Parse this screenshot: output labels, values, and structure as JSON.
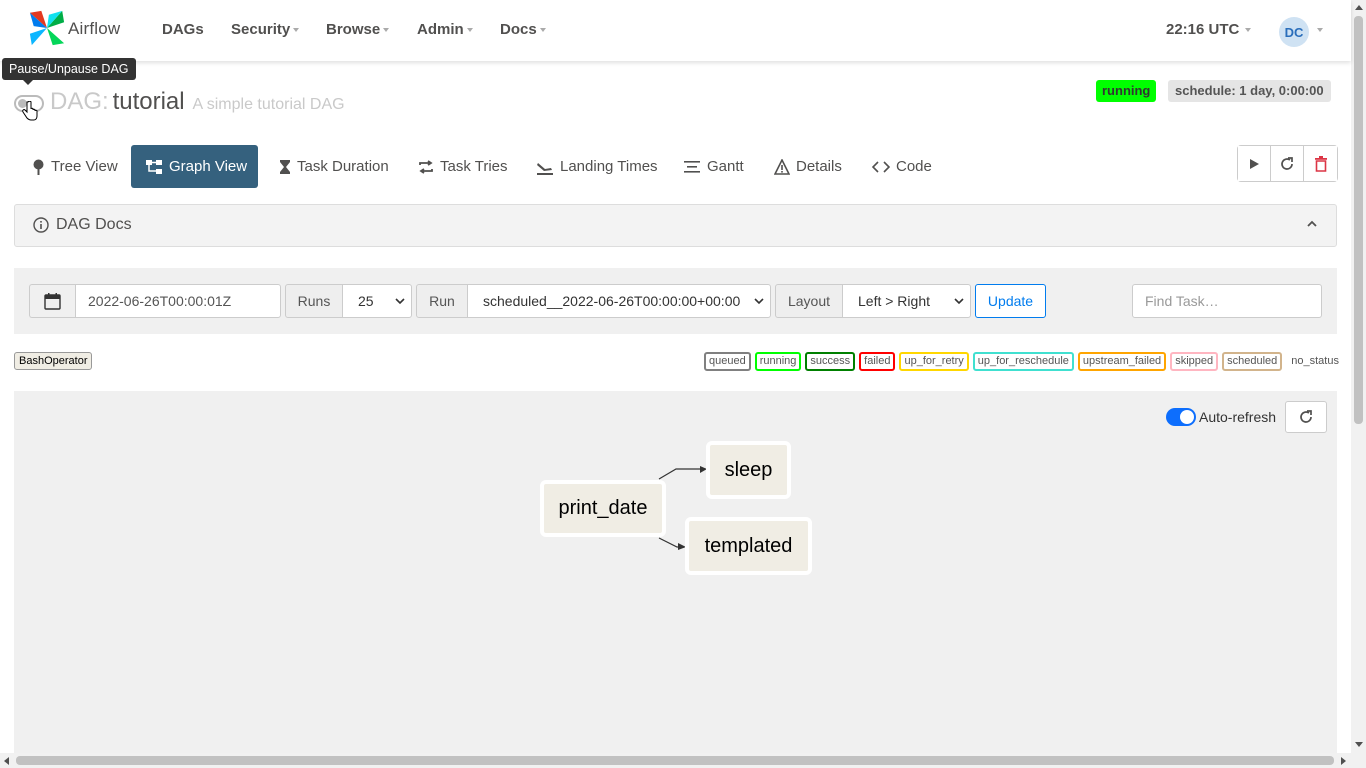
{
  "navbar": {
    "brand": "Airflow",
    "menu": [
      {
        "label": "DAGs",
        "dropdown": false
      },
      {
        "label": "Security",
        "dropdown": true
      },
      {
        "label": "Browse",
        "dropdown": true
      },
      {
        "label": "Admin",
        "dropdown": true
      },
      {
        "label": "Docs",
        "dropdown": true
      }
    ],
    "time": "22:16 UTC",
    "user_initials": "DC"
  },
  "tooltip": "Pause/Unpause DAG",
  "dag": {
    "prefix": "DAG:",
    "name": "tutorial",
    "description": "A simple tutorial DAG",
    "state": "running",
    "schedule": "schedule: 1 day, 0:00:00",
    "paused": true
  },
  "tabs": [
    {
      "label": "Tree View",
      "icon": "tree-icon",
      "active": false
    },
    {
      "label": "Graph View",
      "icon": "graph-icon",
      "active": true
    },
    {
      "label": "Task Duration",
      "icon": "hourglass-icon",
      "active": false
    },
    {
      "label": "Task Tries",
      "icon": "retry-icon",
      "active": false
    },
    {
      "label": "Landing Times",
      "icon": "landing-icon",
      "active": false
    },
    {
      "label": "Gantt",
      "icon": "gantt-icon",
      "active": false
    },
    {
      "label": "Details",
      "icon": "warning-icon",
      "active": false
    },
    {
      "label": "Code",
      "icon": "code-icon",
      "active": false
    }
  ],
  "dag_docs": {
    "label": "DAG Docs"
  },
  "run_form": {
    "base_date": "2022-06-26T00:00:01Z",
    "runs_label": "Runs",
    "runs_value": "25",
    "run_label": "Run",
    "run_value": "scheduled__2022-06-26T00:00:00+00:00",
    "layout_label": "Layout",
    "layout_value": "Left > Right",
    "update_label": "Update",
    "find_placeholder": "Find Task…"
  },
  "operators": [
    "BashOperator"
  ],
  "legend": [
    {
      "label": "queued",
      "color": "#808080"
    },
    {
      "label": "running",
      "color": "#00ff00"
    },
    {
      "label": "success",
      "color": "#008000"
    },
    {
      "label": "failed",
      "color": "#ff0000"
    },
    {
      "label": "up_for_retry",
      "color": "#ffd700"
    },
    {
      "label": "up_for_reschedule",
      "color": "#40e0d0"
    },
    {
      "label": "upstream_failed",
      "color": "#ffa500"
    },
    {
      "label": "skipped",
      "color": "#ffb6c1"
    },
    {
      "label": "scheduled",
      "color": "#d2b48c"
    },
    {
      "label": "no_status",
      "color": "none"
    }
  ],
  "graph": {
    "auto_refresh_label": "Auto-refresh",
    "auto_refresh": true,
    "nodes": [
      "print_date",
      "sleep",
      "templated"
    ],
    "edges": [
      [
        "print_date",
        "sleep"
      ],
      [
        "print_date",
        "templated"
      ]
    ]
  }
}
